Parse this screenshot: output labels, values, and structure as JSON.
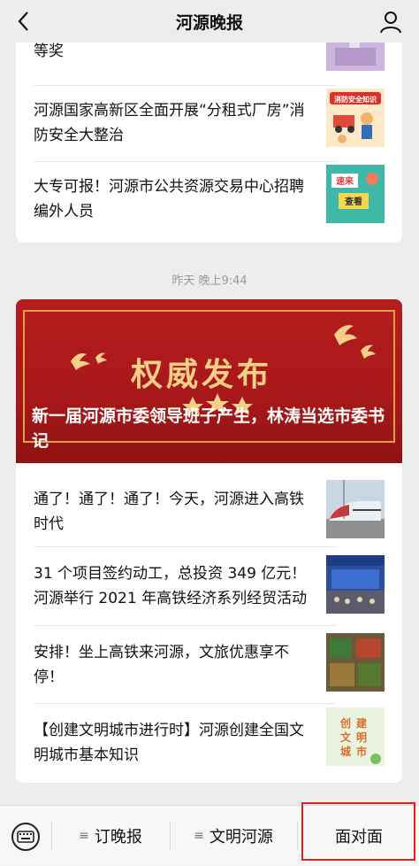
{
  "header": {
    "title": "河源晚报",
    "back_icon": "chevron-left-icon",
    "user_icon": "person-icon"
  },
  "feed_top": {
    "items": [
      {
        "title": "等奖",
        "thumb": "award-photo"
      },
      {
        "title": "河源国家高新区全面开展“分租式厂房”消防安全大整治",
        "thumb": "fire-safety-poster",
        "thumb_caption": "消防安全知识"
      },
      {
        "title": "大专可报！河源市公共资源交易中心招聘编外人员",
        "thumb": "recruit-poster",
        "thumb_caption": "速来查看"
      }
    ]
  },
  "timestamp": "昨天 晚上9:44",
  "feed_main": {
    "banner": {
      "big_text": "权威发布",
      "headline": "新一届河源市委领导班子产生，林涛当选市委书记"
    },
    "items": [
      {
        "title": "通了！通了！通了！今天，河源进入高铁时代",
        "thumb": "high-speed-train-photo"
      },
      {
        "title": "31 个项目签约动工，总投资 349 亿元！河源举行 2021 年高铁经济系列经贸活动",
        "thumb": "event-stage-photo"
      },
      {
        "title": "安排！坐上高铁来河源，文旅优惠享不停！",
        "thumb": "local-products-photo"
      },
      {
        "title": "【创建文明城市进行时】河源创建全国文明城市基本知识",
        "thumb": "civilized-city-poster",
        "thumb_caption": "创建文明城市"
      }
    ]
  },
  "bottom_menu": {
    "keyboard_icon": "keyboard-icon",
    "items": [
      {
        "label": "订晚报"
      },
      {
        "label": "文明河源"
      },
      {
        "label": "面对面"
      }
    ]
  },
  "colors": {
    "banner_red": "#b51d1d",
    "highlight_red": "#e02020",
    "gold": "#d9a441"
  }
}
